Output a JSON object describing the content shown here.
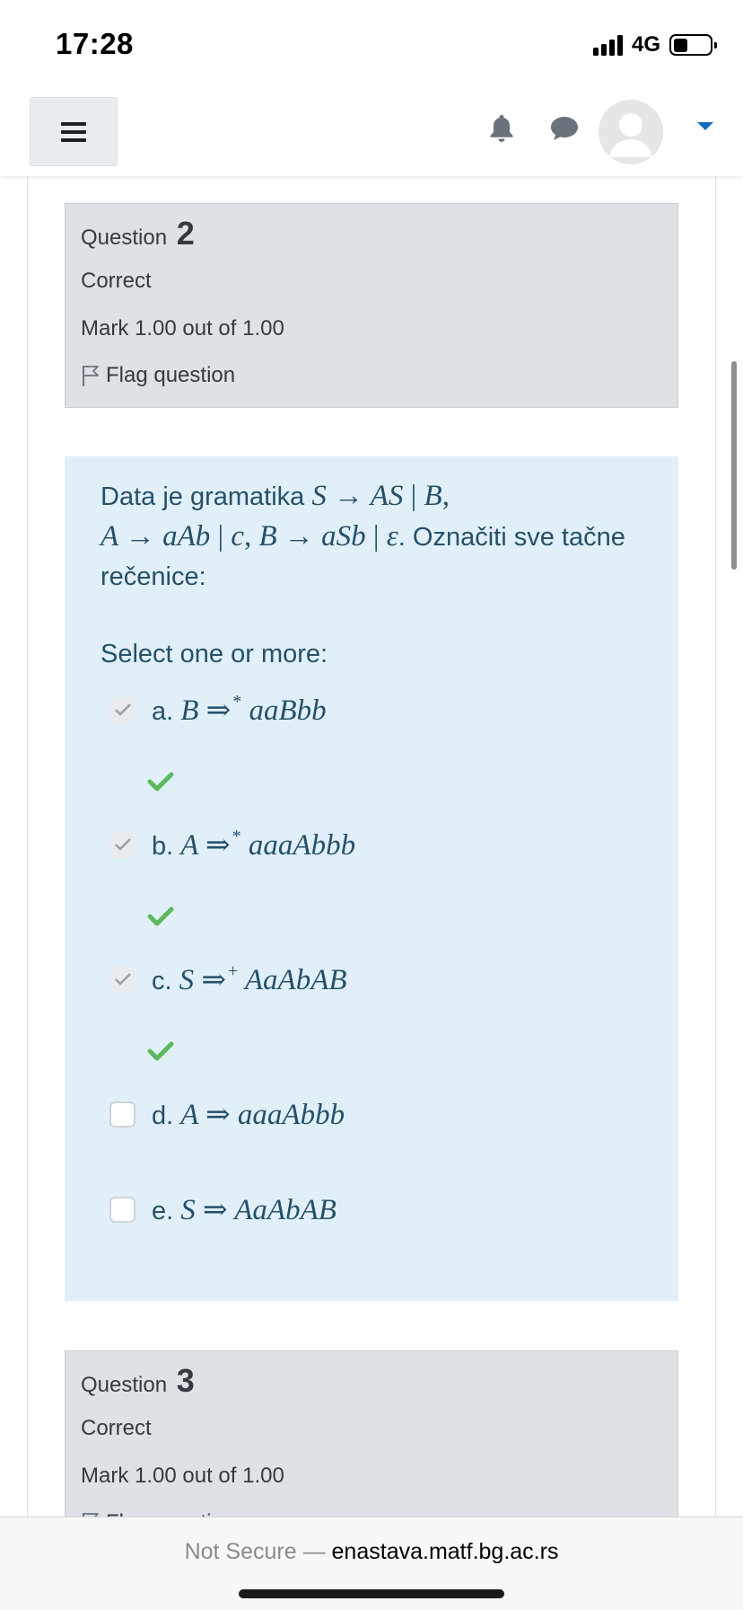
{
  "status_bar": {
    "time": "17:28",
    "network": "4G"
  },
  "navbar": {
    "menu_icon": "hamburger-icon",
    "notification_icon": "bell-icon",
    "messages_icon": "chat-bubble-icon",
    "user_icon": "avatar",
    "dropdown_icon": "caret-down-icon",
    "accent_color": "#0f6cbf"
  },
  "question2": {
    "label": "Question",
    "number": "2",
    "state": "Correct",
    "mark": "Mark 1.00 out of 1.00",
    "flag_label": "Flag question",
    "text_intro": "Data je gramatika",
    "text_outro": ". Označiti sve tačne rečenice:",
    "prompt": "Select one or more:",
    "answers": [
      {
        "letter": "a.",
        "checked": true,
        "correct": true
      },
      {
        "letter": "b.",
        "checked": true,
        "correct": true
      },
      {
        "letter": "c.",
        "checked": true,
        "correct": true
      },
      {
        "letter": "d.",
        "checked": false,
        "correct": false
      },
      {
        "letter": "e.",
        "checked": false,
        "correct": false
      }
    ],
    "correct_color": "#5cb85c",
    "background_color": "#e1f0f8"
  },
  "question3": {
    "label": "Question",
    "number": "3",
    "state": "Correct",
    "mark": "Mark 1.00 out of 1.00",
    "flag_label": "Flag question"
  },
  "browser": {
    "security": "Not Secure —",
    "domain": "enastava.matf.bg.ac.rs"
  }
}
